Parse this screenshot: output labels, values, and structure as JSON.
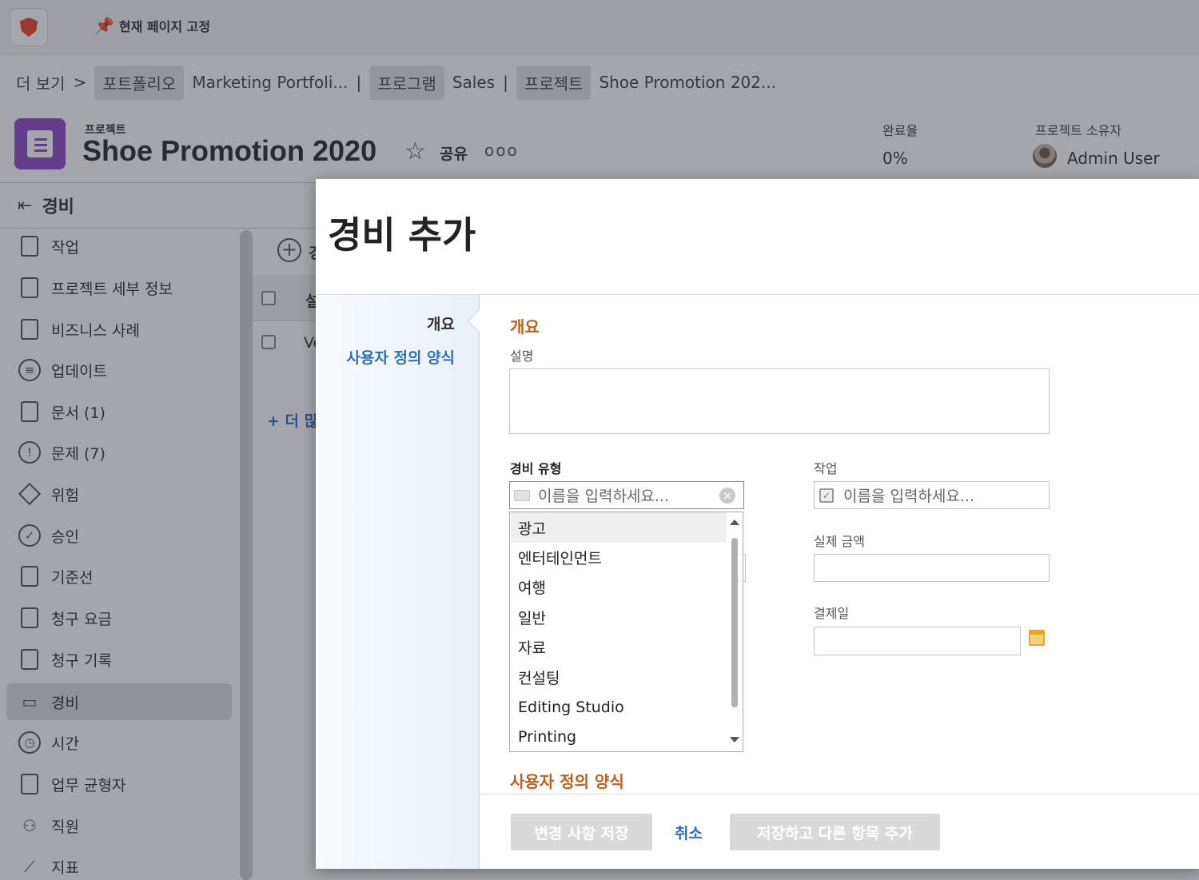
{
  "topbar": {
    "pin_label": "현재 페이지 고정"
  },
  "breadcrumb": {
    "more": "더 보기",
    "sep": ">",
    "items": [
      {
        "kind": "포트폴리오",
        "name": "Marketing Portfoli..."
      },
      {
        "kind": "프로그램",
        "name": "Sales"
      },
      {
        "kind": "프로젝트",
        "name": "Shoe Promotion 202..."
      }
    ],
    "divider": "|"
  },
  "project": {
    "kind": "프로젝트",
    "title": "Shoe Promotion 2020",
    "share": "공유",
    "more": "ooo",
    "completion_label": "완료율",
    "completion_value": "0%",
    "owner_label": "프로젝트 소유자",
    "owner_name": "Admin User"
  },
  "nav": {
    "title": "경비",
    "items": [
      {
        "label": "작업",
        "icon": "clipboard-check-icon"
      },
      {
        "label": "프로젝트 세부 정보",
        "icon": "document-lines-icon"
      },
      {
        "label": "비즈니스 사례",
        "icon": "business-case-icon"
      },
      {
        "label": "업데이트",
        "icon": "chat-bubble-icon"
      },
      {
        "label": "문서 (1)",
        "icon": "file-icon"
      },
      {
        "label": "문제 (7)",
        "icon": "issue-icon"
      },
      {
        "label": "위험",
        "icon": "risk-diamond-icon"
      },
      {
        "label": "승인",
        "icon": "check-circle-icon"
      },
      {
        "label": "기준선",
        "icon": "baseline-icon"
      },
      {
        "label": "청구 요금",
        "icon": "billing-rates-icon"
      },
      {
        "label": "청구 기록",
        "icon": "billing-records-icon"
      },
      {
        "label": "경비",
        "icon": "money-icon",
        "active": true
      },
      {
        "label": "시간",
        "icon": "clock-icon"
      },
      {
        "label": "업무 균형자",
        "icon": "calendar-icon"
      },
      {
        "label": "직원",
        "icon": "people-icon"
      },
      {
        "label": "지표",
        "icon": "chart-line-icon"
      }
    ]
  },
  "background": {
    "add_label_fragment": "경",
    "col_fragment": "설",
    "row_fragment": "Ve",
    "more_link": "+ 더 많"
  },
  "modal": {
    "title": "경비 추가",
    "left_nav": {
      "current": "개요",
      "other": "사용자 정의 양식"
    },
    "section_overview": "개요",
    "description_label": "설명",
    "description_value": "",
    "expense_type_label": "경비 유형",
    "expense_type_placeholder": "이름을 입력하세요...",
    "task_label": "작업",
    "task_placeholder": "이름을 입력하세요...",
    "actual_amount_label": "실제 금액",
    "actual_amount_value": "",
    "payment_date_label": "결제일",
    "payment_date_value": "",
    "section_custom": "사용자 정의 양식",
    "dropdown_options": [
      "광고",
      "엔터테인먼트",
      "여행",
      "일반",
      "자료",
      "컨설팅",
      "Editing Studio",
      "Printing"
    ],
    "dropdown_highlighted": "광고",
    "buttons": {
      "save": "변경 사항 저장",
      "cancel": "취소",
      "save_add": "저장하고 다른 항목 추가"
    }
  },
  "colors": {
    "accent_blue": "#2d6ebd",
    "section_orange": "#c15f1a",
    "project_purple": "#8c4ac7"
  }
}
